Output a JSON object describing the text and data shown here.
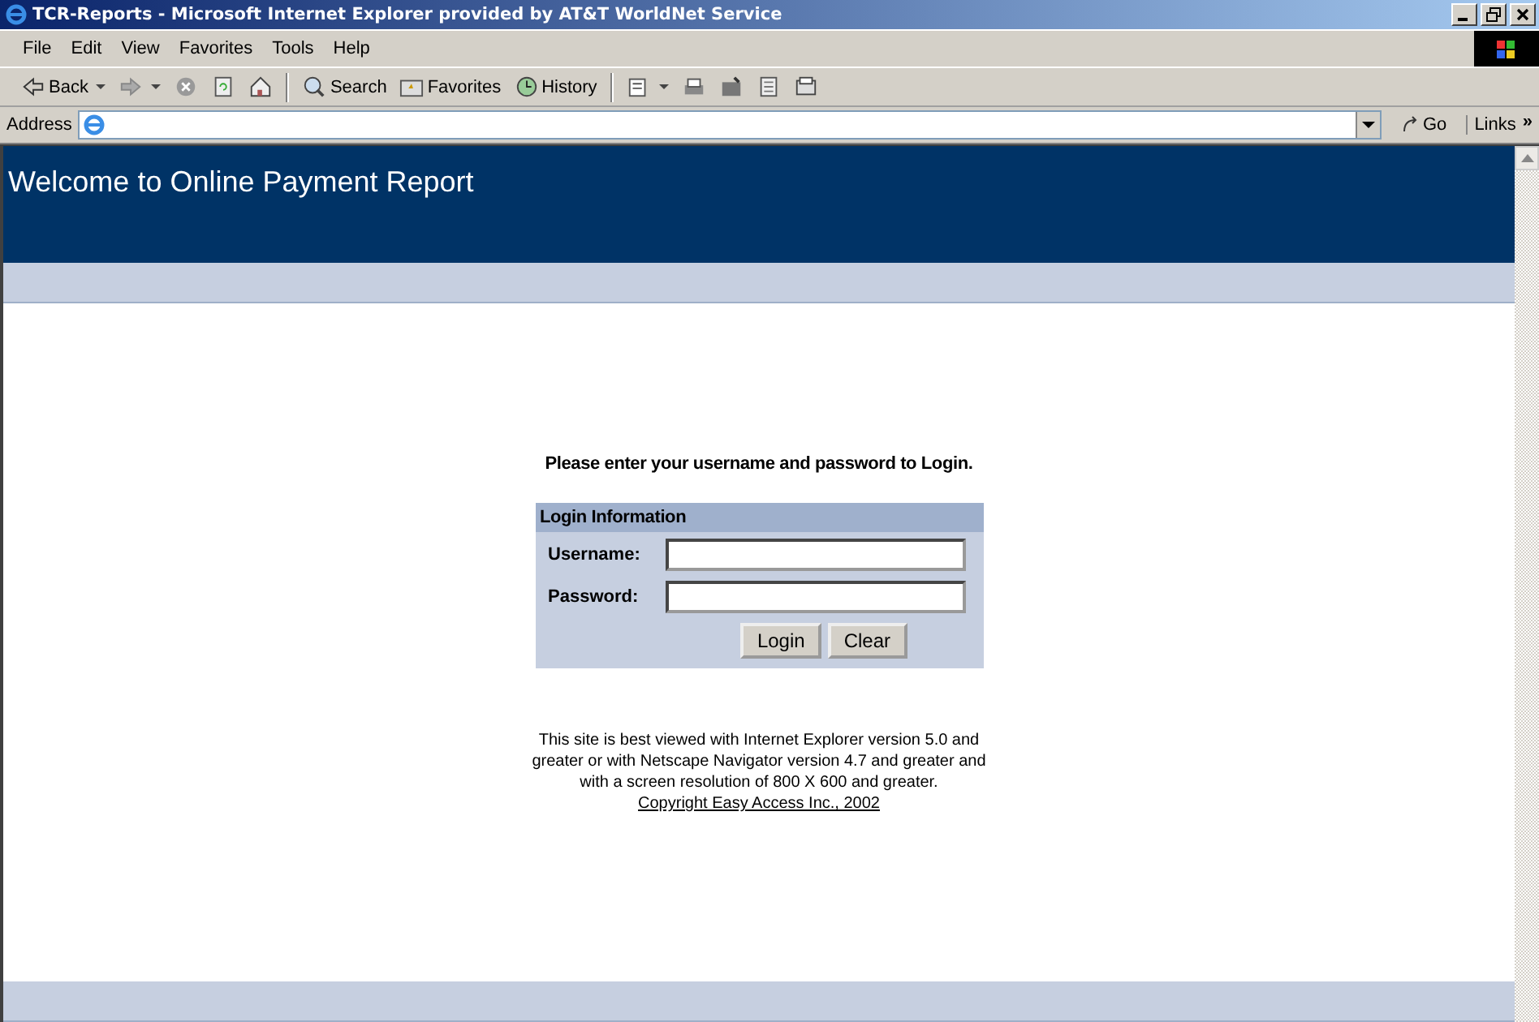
{
  "window": {
    "title": "TCR-Reports - Microsoft Internet Explorer provided by AT&T WorldNet Service"
  },
  "menu": [
    "File",
    "Edit",
    "View",
    "Favorites",
    "Tools",
    "Help"
  ],
  "toolbar": [
    {
      "kind": "back",
      "label": "Back"
    },
    {
      "kind": "forward"
    },
    {
      "kind": "stop"
    },
    {
      "kind": "refresh"
    },
    {
      "kind": "home"
    },
    {
      "kind": "search",
      "label": "Search"
    },
    {
      "kind": "favorites",
      "label": "Favorites"
    },
    {
      "kind": "history",
      "label": "History"
    },
    {
      "kind": "mail"
    },
    {
      "kind": "print"
    },
    {
      "kind": "edit"
    },
    {
      "kind": "discuss"
    },
    {
      "kind": "messenger"
    }
  ],
  "address": {
    "label": "Address",
    "go": "Go",
    "links": "Links",
    "chevron": "»"
  },
  "page": {
    "header": "Welcome to Online Payment Report",
    "prompt": "Please enter your username and password to Login.",
    "panel_title": "Login Information",
    "fields": [
      {
        "label": "Username:"
      },
      {
        "label": "Password:"
      }
    ],
    "buttons": [
      "Login",
      "Clear"
    ],
    "notice": "This site is best viewed with Internet Explorer version 5.0 and greater or with Netscape Navigator version 4.7 and greater and with a screen resolution of 800 X 600 and greater.",
    "copyright": "Copyright Easy Access Inc., 2002"
  }
}
